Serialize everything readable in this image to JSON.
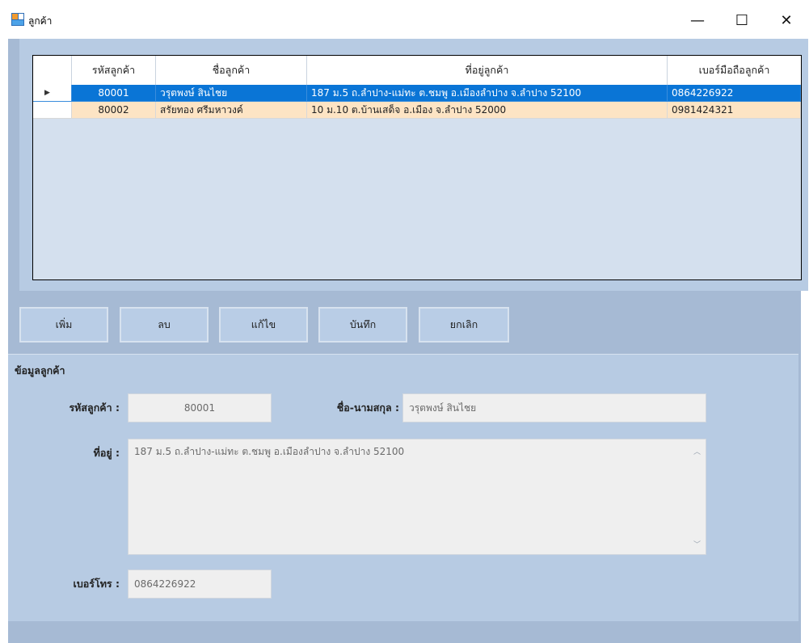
{
  "window": {
    "title": "ลูกค้า",
    "controls": {
      "minimize": "—",
      "maximize": "☐",
      "close": "✕"
    }
  },
  "grid": {
    "columns": [
      "รหัสลูกค้า",
      "ชื่อลูกค้า",
      "ที่อยู่ลูกค้า",
      "เบอร์มือถือลูกค้า"
    ],
    "rows": [
      {
        "indicator": "▶",
        "id": "80001",
        "name": "วรุตพงษ์  สินไชย",
        "address": "187 ม.5 ถ.ลำปาง-แม่ทะ ต.ชมพู อ.เมืองลำปาง จ.ลำปาง 52100",
        "phone": "0864226922"
      },
      {
        "indicator": "",
        "id": "80002",
        "name": "สรัยทอง ศรีมหาวงค์",
        "address": "10 ม.10 ต.บ้านเสด็จ อ.เมือง จ.ลำปาง 52000",
        "phone": "0981424321"
      }
    ]
  },
  "buttons": {
    "add": "เพิ่ม",
    "delete": "ลบ",
    "edit": "แก้ไข",
    "save": "บันทึก",
    "cancel": "ยกเลิก"
  },
  "details": {
    "group_title": "ข้อมูลลูกค้า",
    "id_label": "รหัสลูกค้า :",
    "id_value": "80001",
    "name_label": "ชื่อ-นามสกุล :",
    "name_value": "วรุตพงษ์  สินไชย",
    "address_label": "ที่อยู่ :",
    "address_value": "187 ม.5 ถ.ลำปาง-แม่ทะ ต.ชมพู อ.เมืองลำปาง จ.ลำปาง 52100",
    "phone_label": "เบอร์โทร :",
    "phone_value": "0864226922"
  },
  "colors": {
    "selected_row": "#0a75d6",
    "alt_row": "#fde4c4",
    "panel": "#b7cbe3",
    "client": "#a6bad4"
  }
}
